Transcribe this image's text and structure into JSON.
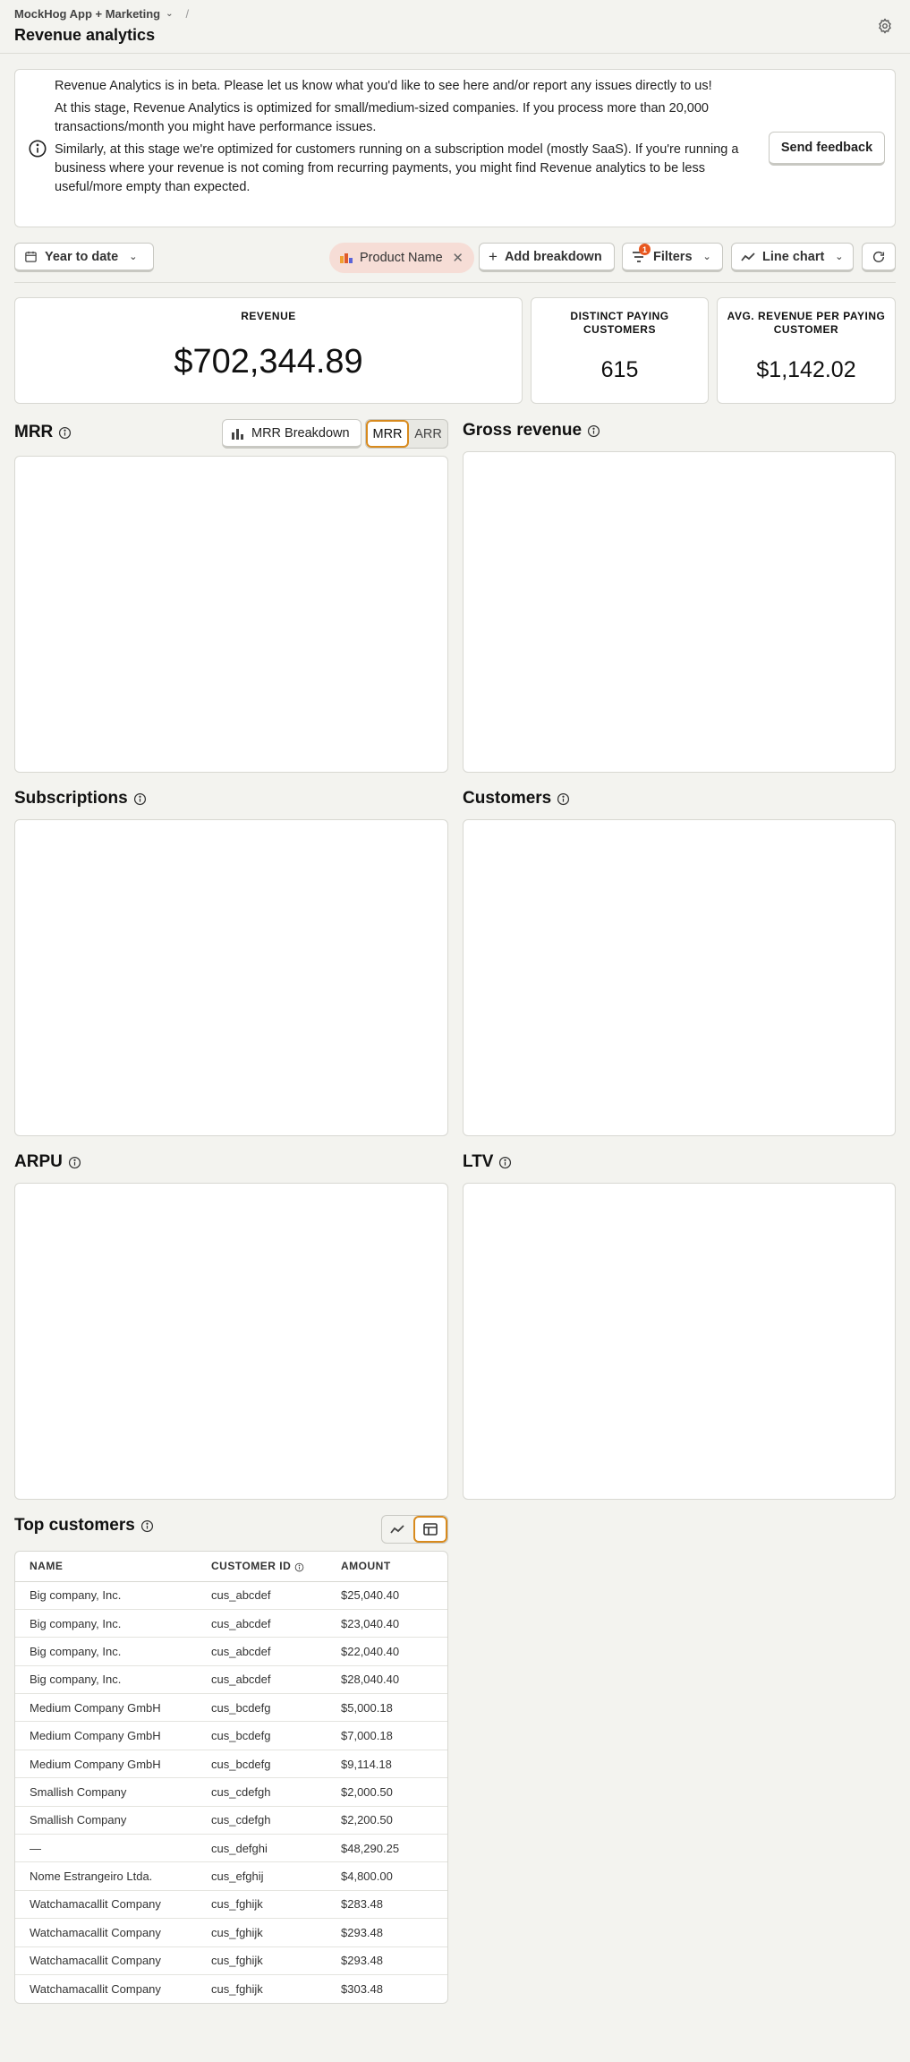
{
  "header": {
    "project": "MockHog App + Marketing",
    "separator": "/",
    "title": "Revenue analytics"
  },
  "banner": {
    "p1": "Revenue Analytics is in beta. Please let us know what you'd like to see here and/or report any issues directly to us!",
    "p2": "At this stage, Revenue Analytics is optimized for small/medium-sized companies. If you process more than 20,000 transactions/month you might have performance issues.",
    "p3": "Similarly, at this stage we're optimized for customers running on a subscription model (mostly SaaS). If you're running a business where your revenue is not coming from recurring payments, you might find Revenue analytics to be less useful/more empty than expected.",
    "feedback": "Send feedback"
  },
  "toolbar": {
    "date_range": "Year to date",
    "breakdown_chip": "Product Name",
    "add_breakdown": "Add breakdown",
    "filters": "Filters",
    "filters_count": "1",
    "chart_type": "Line chart"
  },
  "stats": {
    "revenue_label": "REVENUE",
    "revenue_value": "$702,344.89",
    "paying_label": "DISTINCT PAYING CUSTOMERS",
    "paying_value": "615",
    "arpc_label": "AVG. REVENUE PER PAYING CUSTOMER",
    "arpc_value": "$1,142.02"
  },
  "sections": {
    "mrr": "MRR",
    "mrr_breakdown": "MRR Breakdown",
    "mrr_toggle": "MRR",
    "arr_toggle": "ARR",
    "gross_revenue": "Gross revenue",
    "subscriptions": "Subscriptions",
    "customers": "Customers",
    "arpu": "ARPU",
    "ltv": "LTV",
    "top_customers": "Top customers"
  },
  "top_customers": {
    "headers": [
      "NAME",
      "CUSTOMER ID",
      "AMOUNT"
    ],
    "rows": [
      [
        "Big company, Inc.",
        "cus_abcdef",
        "$25,040.40"
      ],
      [
        "Big company, Inc.",
        "cus_abcdef",
        "$23,040.40"
      ],
      [
        "Big company, Inc.",
        "cus_abcdef",
        "$22,040.40"
      ],
      [
        "Big company, Inc.",
        "cus_abcdef",
        "$28,040.40"
      ],
      [
        "Medium Company GmbH",
        "cus_bcdefg",
        "$5,000.18"
      ],
      [
        "Medium Company GmbH",
        "cus_bcdefg",
        "$7,000.18"
      ],
      [
        "Medium Company GmbH",
        "cus_bcdefg",
        "$9,114.18"
      ],
      [
        "Smallish Company",
        "cus_cdefgh",
        "$2,000.50"
      ],
      [
        "Smallish Company",
        "cus_cdefgh",
        "$2,200.50"
      ],
      [
        "—",
        "cus_defghi",
        "$48,290.25"
      ],
      [
        "Nome Estrangeiro Ltda.",
        "cus_efghij",
        "$4,800.00"
      ],
      [
        "Watchamacallit Company",
        "cus_fghijk",
        "$283.48"
      ],
      [
        "Watchamacallit Company",
        "cus_fghijk",
        "$293.48"
      ],
      [
        "Watchamacallit Company",
        "cus_fghijk",
        "$293.48"
      ],
      [
        "Watchamacallit Company",
        "cus_fghijk",
        "$303.48"
      ]
    ]
  }
}
